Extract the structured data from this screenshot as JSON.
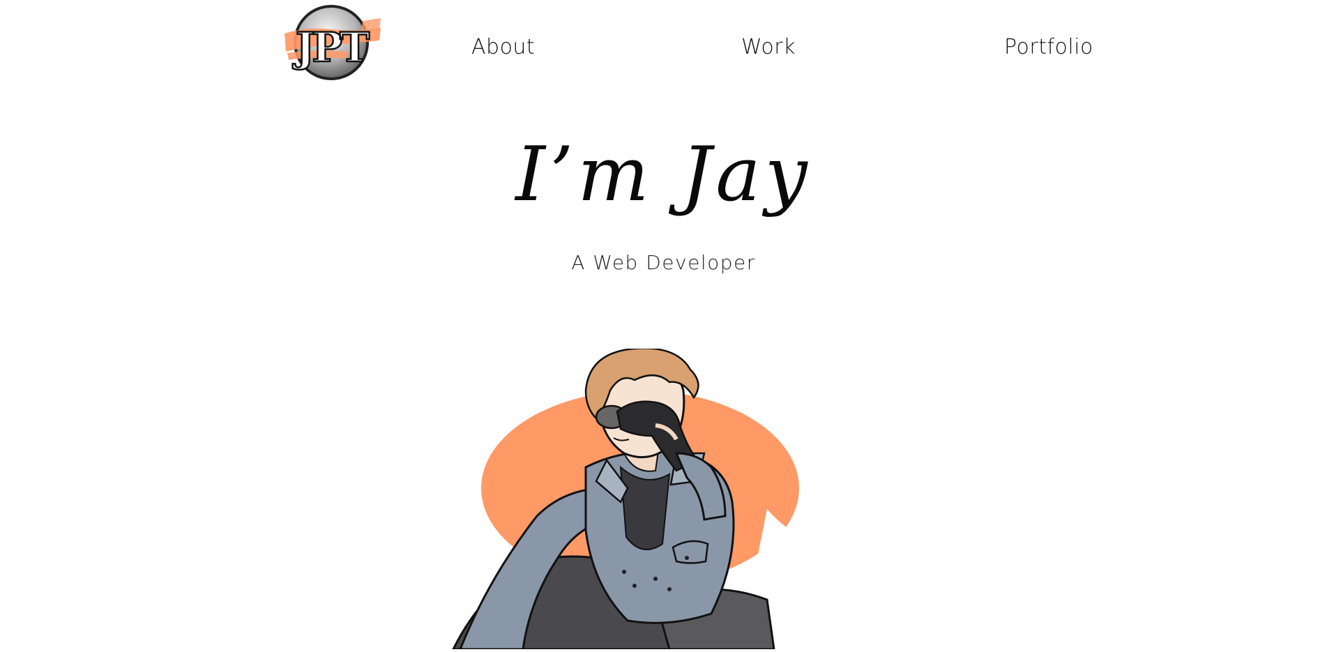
{
  "nav": {
    "logo_text": "JPT",
    "items": [
      {
        "label": "About"
      },
      {
        "label": "Work"
      },
      {
        "label": "Portfolio"
      }
    ]
  },
  "hero": {
    "title": "I’m Jay",
    "subtitle": "A Web Developer"
  },
  "colors": {
    "accent": "#ff9966",
    "jacket": "#8a97a8",
    "hair": "#d9a070",
    "text": "#111111"
  }
}
